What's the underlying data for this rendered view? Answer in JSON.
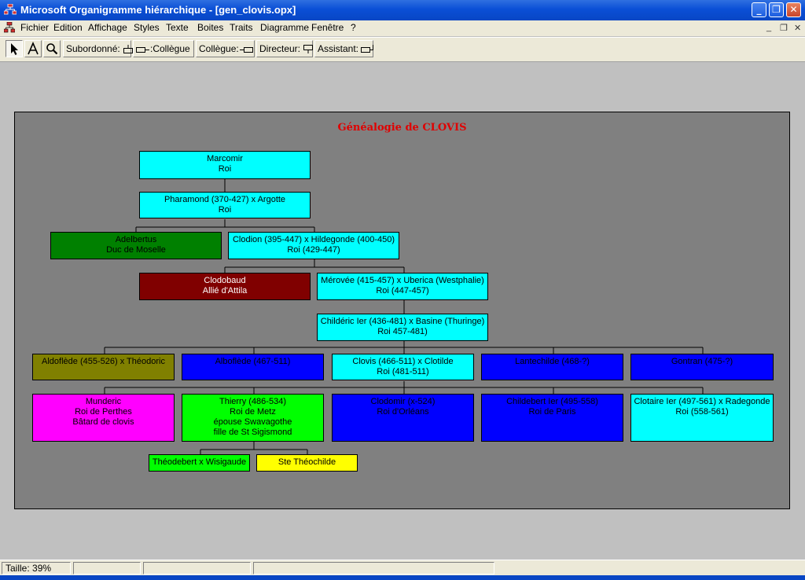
{
  "window": {
    "title": "Microsoft Organigramme hiérarchique - [gen_clovis.opx]",
    "minimize_glyph": "_",
    "restore_glyph": "❐",
    "close_glyph": "✕"
  },
  "menu": {
    "items": [
      "Fichier",
      "Edition",
      "Affichage",
      "Styles",
      "Texte",
      "Boites",
      "Traits",
      "Diagramme",
      "Fenêtre",
      "?"
    ],
    "mdi": {
      "minimize": "_",
      "restore": "❐",
      "close": "✕"
    }
  },
  "toolbar": {
    "subordonne": "Subordonné:",
    "collegue_left": ":Collègue",
    "collegue_right": "Collègue:",
    "directeur": "Directeur:",
    "assistant": "Assistant:"
  },
  "chart": {
    "title": "Généalogie de CLOVIS",
    "title_color": "#e00000",
    "background": "#808080",
    "boxes": [
      {
        "id": "marcomir",
        "lines": [
          "Marcomir",
          "Roi"
        ],
        "fill": "#00ffff",
        "text": "#000000"
      },
      {
        "id": "pharamond",
        "lines": [
          "Pharamond (370-427) x Argotte",
          "Roi"
        ],
        "fill": "#00ffff",
        "text": "#000000"
      },
      {
        "id": "adelbertus",
        "lines": [
          "Adelbertus",
          "Duc de Moselle"
        ],
        "fill": "#008000",
        "text": "#000000"
      },
      {
        "id": "clodion",
        "lines": [
          "Clodion (395-447) x Hildegonde (400-450)",
          "Roi (429-447)"
        ],
        "fill": "#00ffff",
        "text": "#000000"
      },
      {
        "id": "clodobaud",
        "lines": [
          "Clodobaud",
          "Allié d'Attila"
        ],
        "fill": "#800000",
        "text": "#ffffff"
      },
      {
        "id": "merovee",
        "lines": [
          "Mérovée (415-457) x Uberica (Westphalie)",
          "Roi (447-457)"
        ],
        "fill": "#00ffff",
        "text": "#000000"
      },
      {
        "id": "childeric",
        "lines": [
          "Childéric Ier (436-481) x Basine (Thuringe)",
          "Roi 457-481)"
        ],
        "fill": "#00ffff",
        "text": "#000000"
      },
      {
        "id": "aldoflede1",
        "lines": [
          "Aldoflède (455-526) x Théodoric"
        ],
        "fill": "#808000",
        "text": "#000000"
      },
      {
        "id": "aldoflede2",
        "lines": [
          "Alboflède (467-511)"
        ],
        "fill": "#0000ff",
        "text": "#000000"
      },
      {
        "id": "clovis",
        "lines": [
          "Clovis (466-511) x Clotilde",
          "Roi (481-511)"
        ],
        "fill": "#00ffff",
        "text": "#000000"
      },
      {
        "id": "lantechilde",
        "lines": [
          "Lantechilde (468-?)"
        ],
        "fill": "#0000ff",
        "text": "#000000"
      },
      {
        "id": "gontran",
        "lines": [
          "Gontran (475-?)"
        ],
        "fill": "#0000ff",
        "text": "#000000"
      },
      {
        "id": "munderic",
        "lines": [
          "Munderic",
          "Roi de Perthes",
          "Bâtard de clovis"
        ],
        "fill": "#ff00ff",
        "text": "#000000"
      },
      {
        "id": "thierry",
        "lines": [
          "Thierry (486-534)",
          "Roi de Metz",
          "épouse Swavagothe",
          "fille de St Sigismond"
        ],
        "fill": "#00ff00",
        "text": "#000000"
      },
      {
        "id": "clodomir",
        "lines": [
          "Clodomir (x-524)",
          "Roi d'Orléans"
        ],
        "fill": "#0000ff",
        "text": "#000000"
      },
      {
        "id": "childebert",
        "lines": [
          "Childebert Ier (495-558)",
          "Roi de Paris"
        ],
        "fill": "#0000ff",
        "text": "#000000"
      },
      {
        "id": "clotaire",
        "lines": [
          "Clotaire Ier (497-561) x Radegonde",
          "Roi (558-561)"
        ],
        "fill": "#00ffff",
        "text": "#000000"
      },
      {
        "id": "theodebert",
        "lines": [
          "Théodebert x Wisigaude"
        ],
        "fill": "#00ff00",
        "text": "#000000"
      },
      {
        "id": "theochilde",
        "lines": [
          "Ste Théochilde"
        ],
        "fill": "#ffff00",
        "text": "#000000"
      }
    ]
  },
  "status": {
    "zoom": "Taille: 39%",
    "p2": "",
    "p3": "",
    "p4": ""
  }
}
